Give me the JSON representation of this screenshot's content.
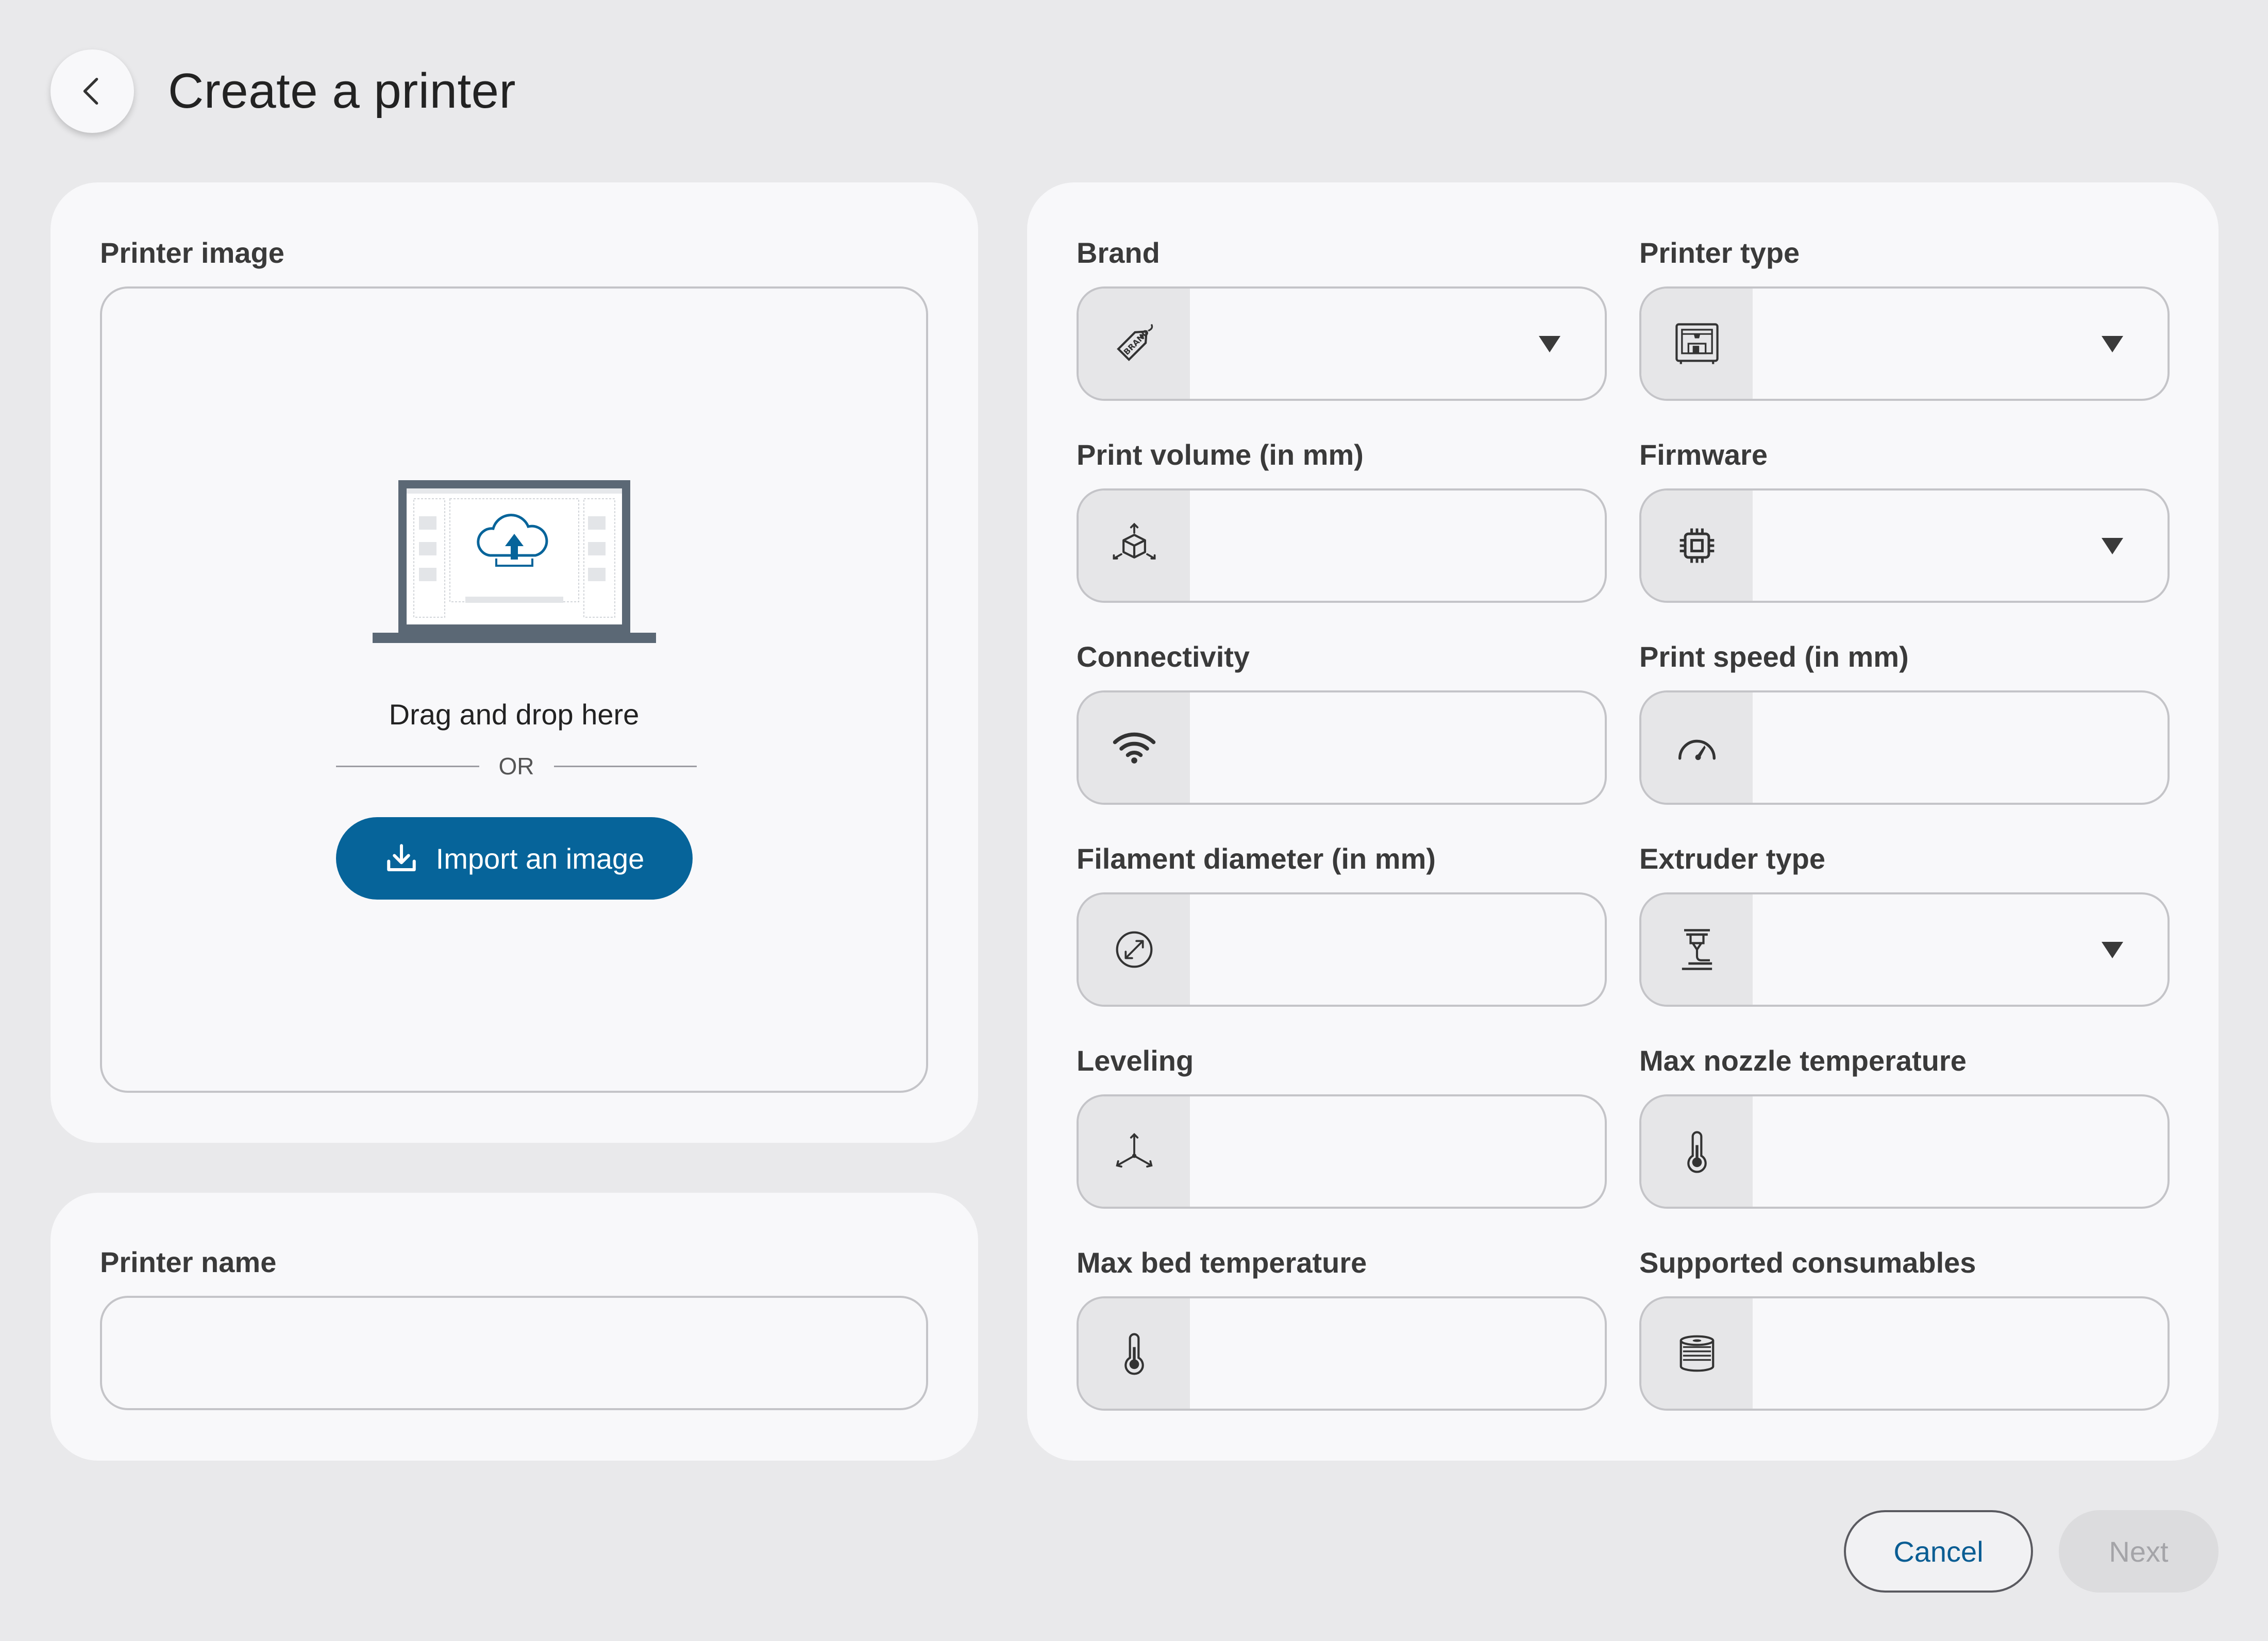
{
  "header": {
    "title": "Create a printer"
  },
  "image_card": {
    "label": "Printer image",
    "drag_text": "Drag and drop here",
    "or_text": "OR",
    "import_label": "Import an image"
  },
  "name_card": {
    "label": "Printer name",
    "value": ""
  },
  "specs": {
    "brand": {
      "label": "Brand",
      "icon": "brand-tag-icon",
      "value": "",
      "dropdown": true
    },
    "printer_type": {
      "label": "Printer type",
      "icon": "printer-icon",
      "value": "",
      "dropdown": true
    },
    "print_volume": {
      "label": "Print volume (in mm)",
      "icon": "cube-icon",
      "value": ""
    },
    "firmware": {
      "label": "Firmware",
      "icon": "chip-icon",
      "value": "",
      "dropdown": true
    },
    "connectivity": {
      "label": "Connectivity",
      "icon": "wifi-icon",
      "value": ""
    },
    "print_speed": {
      "label": "Print speed (in mm)",
      "icon": "speedometer-icon",
      "value": ""
    },
    "filament_diameter": {
      "label": "Filament diameter (in mm)",
      "icon": "diameter-icon",
      "value": ""
    },
    "extruder_type": {
      "label": "Extruder type",
      "icon": "extruder-icon",
      "value": "",
      "dropdown": true
    },
    "leveling": {
      "label": "Leveling",
      "icon": "axes-icon",
      "value": ""
    },
    "max_nozzle_temperature": {
      "label": "Max nozzle temperature",
      "icon": "thermometer-icon",
      "value": ""
    },
    "max_bed_temperature": {
      "label": "Max bed temperature",
      "icon": "thermometer-icon",
      "value": ""
    },
    "supported_consumables": {
      "label": "Supported consumables",
      "icon": "filament-spool-icon",
      "value": ""
    }
  },
  "footer": {
    "cancel_label": "Cancel",
    "next_label": "Next"
  },
  "colors": {
    "background": "#e9e9eb",
    "card": "#f8f8fa",
    "primary": "#06649a",
    "border": "#c4c4c8",
    "disabled_text": "#a4a4a8"
  }
}
